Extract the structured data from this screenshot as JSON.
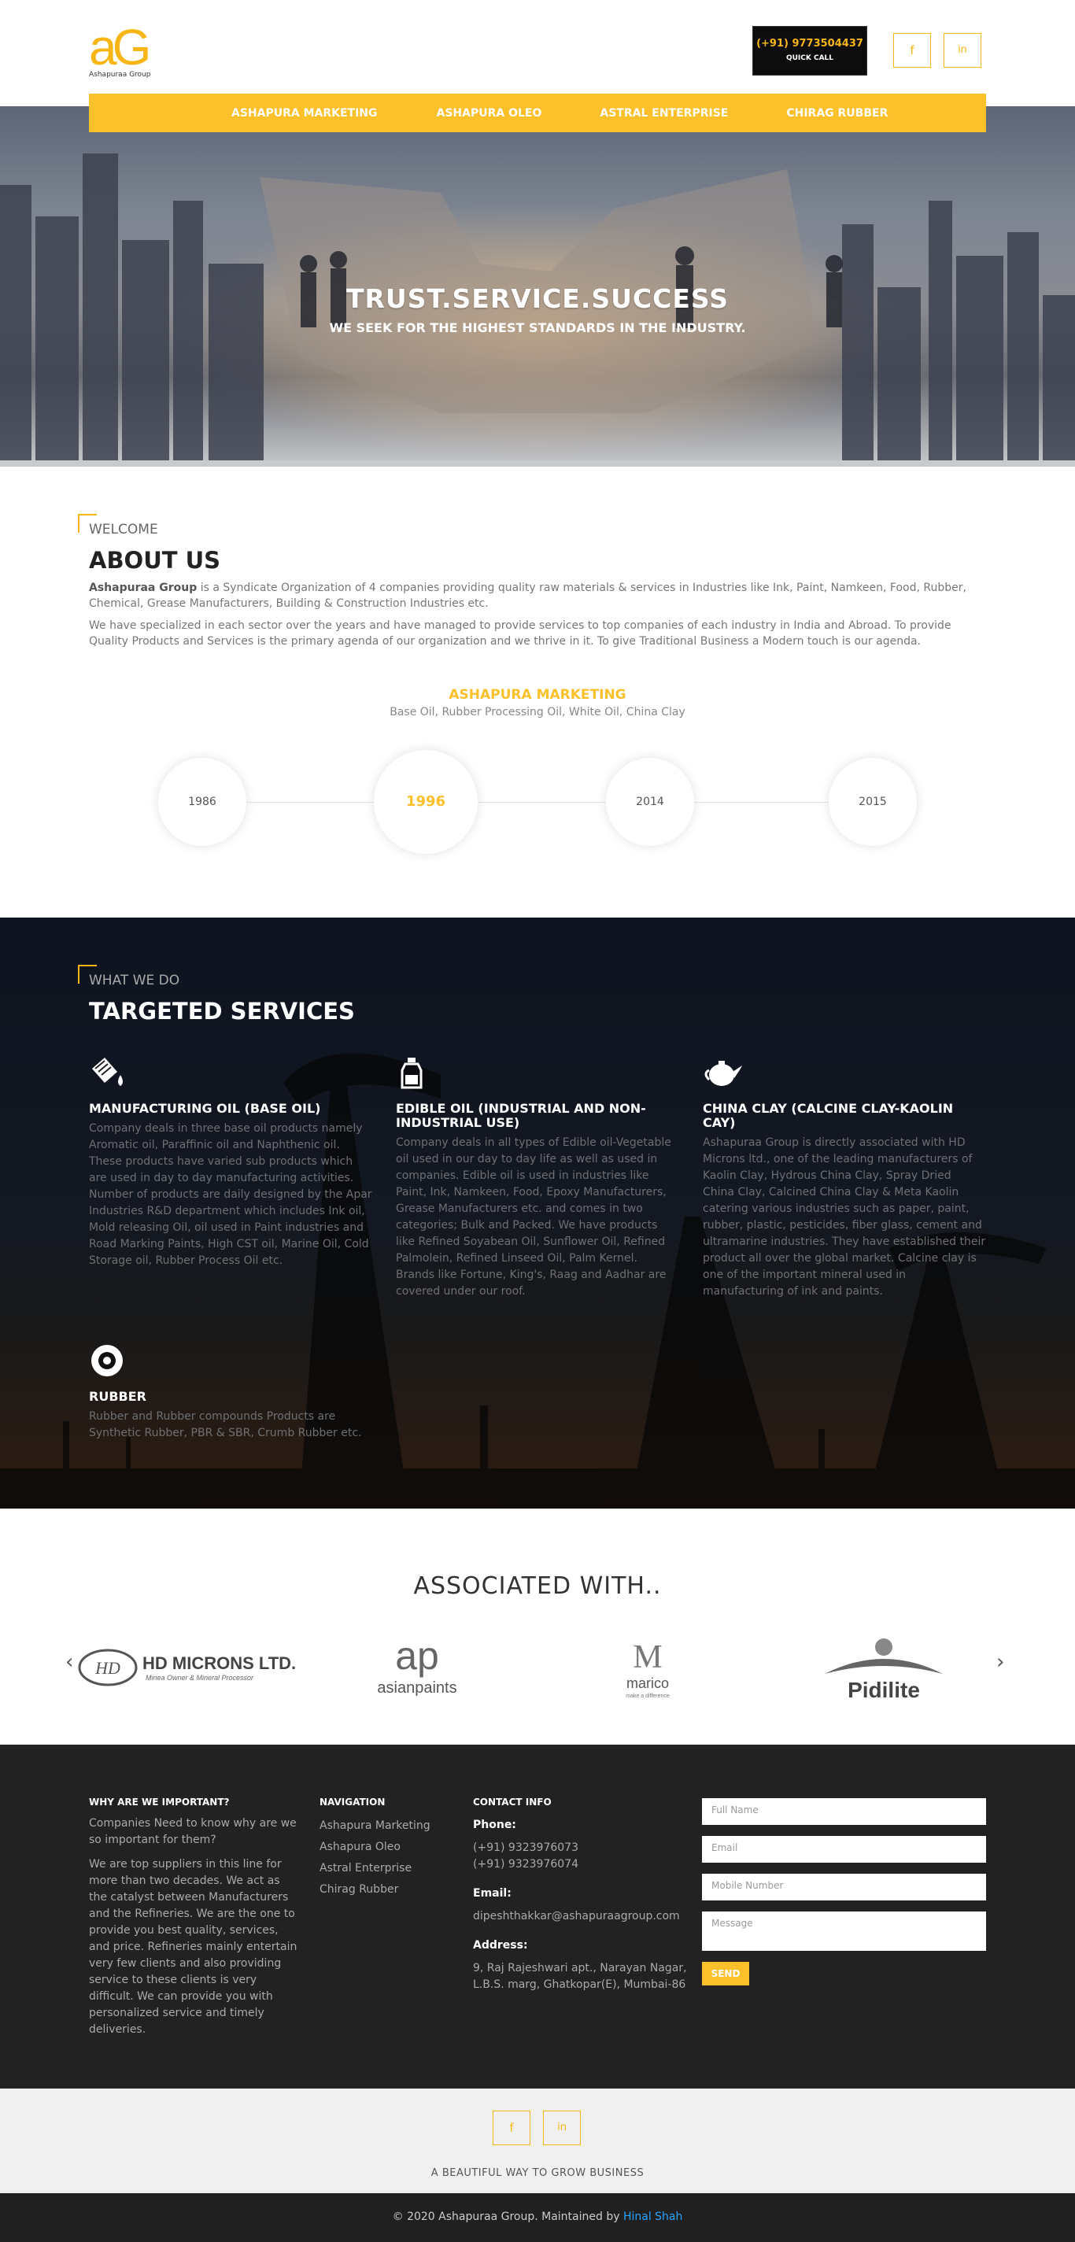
{
  "brand": {
    "logo_text": "aG",
    "name": "Ashapuraa Group",
    "accent": "#f8b616"
  },
  "header": {
    "phone": "(+91) 9773504437",
    "quick_call": "QUICK CALL",
    "social": [
      {
        "icon": "facebook-icon",
        "glyph": "f"
      },
      {
        "icon": "linkedin-icon",
        "glyph": "in"
      }
    ]
  },
  "nav": {
    "items": [
      "ASHAPURA MARKETING",
      "ASHAPURA OLEO",
      "ASTRAL ENTERPRISE",
      "CHIRAG RUBBER"
    ]
  },
  "hero": {
    "title": "TRUST.SERVICE.SUCCESS",
    "subtitle": "WE SEEK FOR THE HIGHEST STANDARDS IN THE INDUSTRY."
  },
  "about": {
    "kicker": "WELCOME",
    "title": "ABOUT US",
    "brand_bold": "Ashapuraa Group",
    "para1": " is a Syndicate Organization of 4 companies providing quality raw materials & services in Industries like Ink, Paint, Namkeen, Food, Rubber, Chemical, Grease Manufacturers, Building & Construction Industries etc.",
    "para2": "We have specialized in each sector over the years and have managed to provide services to top companies of each industry in India and Abroad. To provide Quality Products and Services is the primary agenda of our organization and we thrive in it. To give Traditional Business a Modern touch is our agenda.",
    "timeline_title": "ASHAPURA MARKETING",
    "timeline_sub": "Base Oil, Rubber Processing Oil, White Oil, China Clay",
    "years": [
      "1986",
      "1996",
      "2014",
      "2015"
    ],
    "active_year": "1996"
  },
  "services": {
    "kicker": "WHAT WE DO",
    "title": "TARGETED SERVICES",
    "items": [
      {
        "icon": "oil-drop-icon",
        "title": "MANUFACTURING OIL (BASE OIL)",
        "text": "Company deals in three base oil products namely Aromatic oil, Paraffinic oil and Naphthenic oil. These products have varied sub products which are used in day to day manufacturing activities. Number of products are daily designed by the Apar Industries R&D department which includes Ink oil, Mold releasing Oil, oil used in Paint industries and Road Marking Paints, High CST oil, Marine Oil, Cold Storage oil, Rubber Process Oil etc."
      },
      {
        "icon": "oil-bottle-icon",
        "title": "EDIBLE OIL (INDUSTRIAL AND NON-INDUSTRIAL USE)",
        "text": "Company deals in all types of Edible oil-Vegetable oil used in our day to day life as well as used in companies. Edible oil is used in industries like Paint, Ink, Namkeen, Food, Epoxy Manufacturers, Grease Manufacturers etc. and comes in two categories; Bulk and Packed. We have products like Refined Soyabean Oil, Sunflower Oil, Refined Palmolein, Refined Linseed Oil, Palm Kernel. Brands like Fortune, King's, Raag and Aadhar are covered under our roof."
      },
      {
        "icon": "teapot-icon",
        "title": "CHINA CLAY (CALCINE CLAY-KAOLIN CAY)",
        "text": "Ashapuraa Group is directly associated with HD Microns ltd., one of the leading manufacturers of Kaolin Clay, Hydrous China Clay, Spray Dried China Clay, Calcined China Clay & Meta Kaolin catering various industries such as paper, paint, rubber, plastic, pesticides, fiber glass, cement and ultramarine industries. They have established their product all over the global market. Calcine clay is one of the important mineral used in manufacturing of ink and paints."
      },
      {
        "icon": "tyre-icon",
        "title": "RUBBER",
        "text": "Rubber and Rubber compounds Products are Synthetic Rubber, PBR & SBR, Crumb Rubber etc."
      }
    ]
  },
  "associated": {
    "title": "ASSOCIATED WITH..",
    "logos": [
      {
        "icon": "hd-microns-logo",
        "badge": "HD",
        "name": "HD MICRONS LTD.",
        "tagline": "Minea Owner & Mineral Processor"
      },
      {
        "icon": "asianpaints-logo",
        "badge": "ap",
        "name": "asianpaints"
      },
      {
        "icon": "marico-logo",
        "badge": "M",
        "name": "marico",
        "tagline": "make a difference"
      },
      {
        "icon": "pidilite-logo",
        "name": "Pidilite"
      }
    ]
  },
  "footer": {
    "why_title": "WHY ARE WE IMPORTANT?",
    "why_lead": "Companies Need to know why are we so important for them?",
    "why_text": "We are top suppliers in this line for more than two decades. We act as the catalyst between Manufacturers and the Refineries. We are the one to provide you best quality, services, and price. Refineries mainly entertain very few clients and also providing service to these clients is very difficult. We can provide you with personalized service and timely deliveries.",
    "nav_title": "NAVIGATION",
    "nav_items": [
      "Ashapura Marketing",
      "Ashapura Oleo",
      "Astral Enterprise",
      "Chirag Rubber"
    ],
    "contact_title": "CONTACT INFO",
    "phone_label": "Phone:",
    "phones": [
      "(+91) 9323976073",
      "(+91) 9323976074"
    ],
    "email_label": "Email:",
    "email": "dipeshthakkar@ashapuraagroup.com",
    "address_label": "Address:",
    "address": "9, Raj Rajeshwari apt., Narayan Nagar, L.B.S. marg, Ghatkopar(E), Mumbai-86",
    "form": {
      "name": "Full Name",
      "email": "Email",
      "mobile": "Mobile Number",
      "message": "Message",
      "send": "SEND"
    }
  },
  "bottom": {
    "tagline": "A BEAUTIFUL WAY TO GROW BUSINESS"
  },
  "copyright": {
    "text": "© 2020 Ashapuraa Group. Maintained by ",
    "author": "Hinal Shah"
  }
}
